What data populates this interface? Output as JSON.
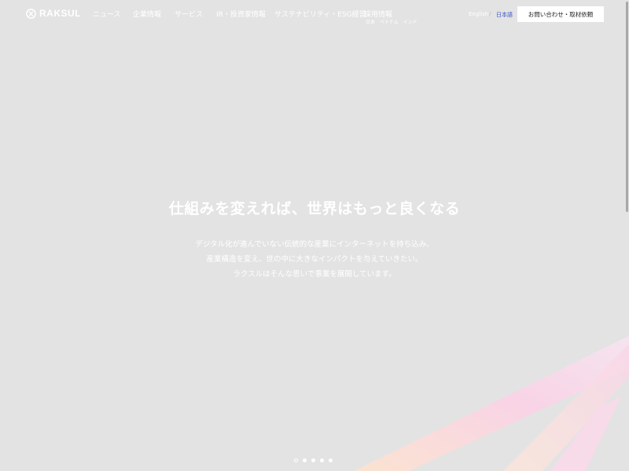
{
  "header": {
    "logo_text": "RAKSUL",
    "nav": [
      {
        "label": "ニュース"
      },
      {
        "label": "企業情報"
      },
      {
        "label": "サービス"
      },
      {
        "label": "IR・投資家情報"
      },
      {
        "label": "サステナビリティ・ESG経営"
      },
      {
        "label": "採用情報",
        "sub": "日本 ベトナム インド"
      }
    ],
    "lang_en": "English",
    "lang_separator": "/",
    "lang_ja": "日本語",
    "contact_label": "お問い合わせ・取材依頼"
  },
  "hero": {
    "title": "仕組みを変えれば、世界はもっと良くなる",
    "lines": [
      "デジタル化が進んでいない伝統的な産業にインターネットを持ち込み、",
      "産業構造を変え、世の中に大きなインパクトを与えていきたい。",
      "ラクスルはそんな思いで事業を展開しています。"
    ]
  },
  "carousel": {
    "slide_count": 5,
    "active_index": 0
  },
  "colors": {
    "background": "#e3e3e3",
    "accent_pink": "#fbd2e6",
    "accent_peach": "#fde3cf",
    "language_active": "#3a55c8"
  }
}
